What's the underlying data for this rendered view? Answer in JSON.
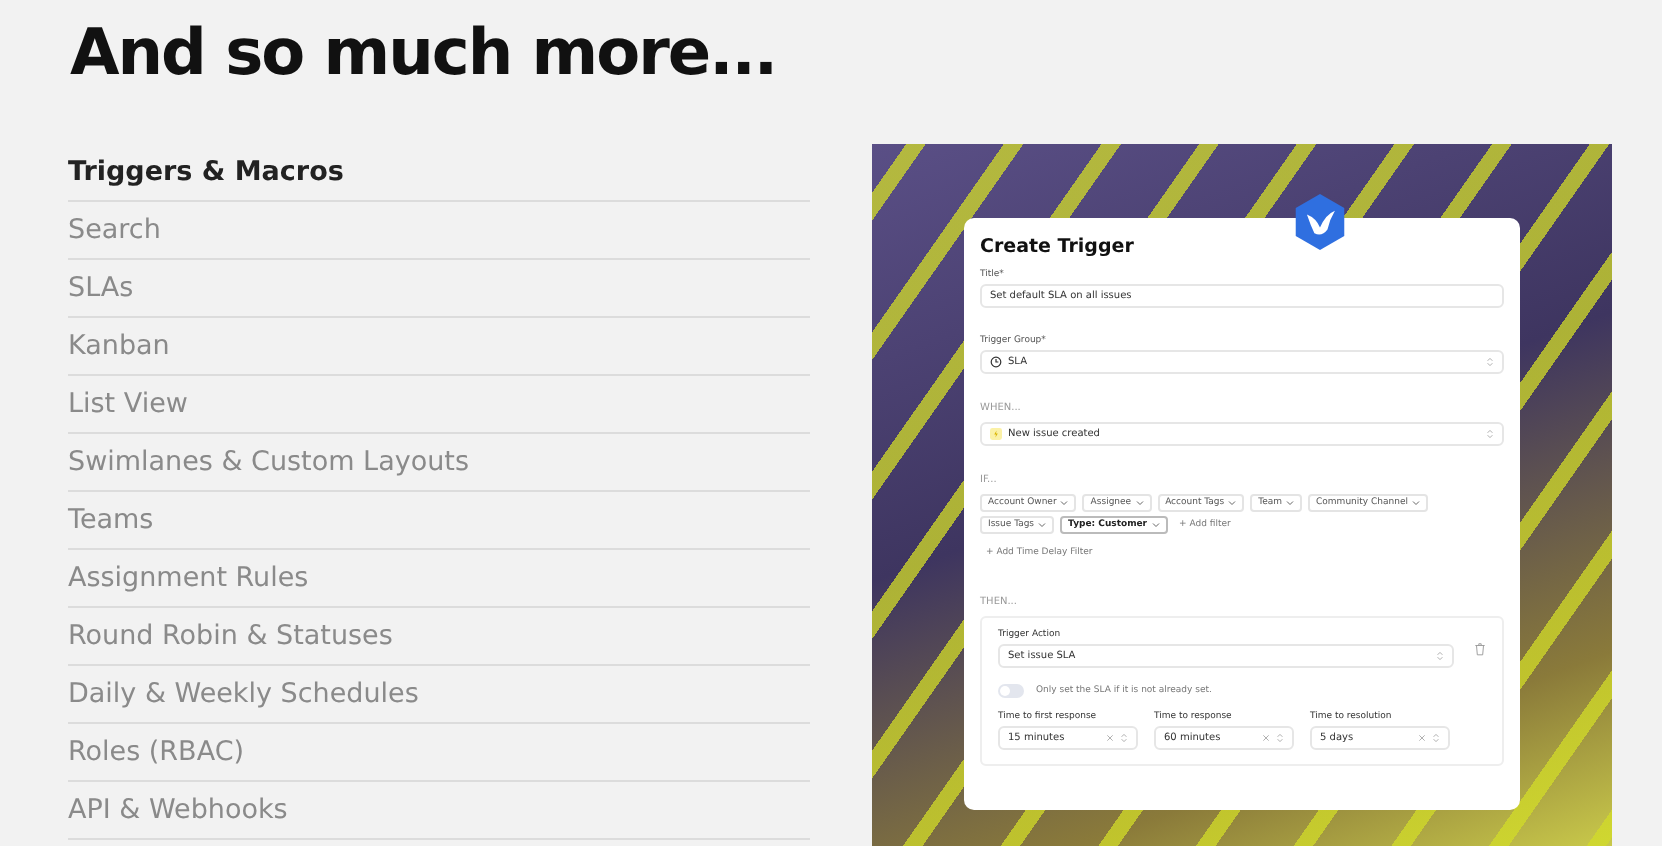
{
  "heading": "And so much more...",
  "features": [
    {
      "label": "Triggers & Macros",
      "selected": true
    },
    {
      "label": "Search",
      "selected": false
    },
    {
      "label": "SLAs",
      "selected": false
    },
    {
      "label": "Kanban",
      "selected": false
    },
    {
      "label": "List View",
      "selected": false
    },
    {
      "label": "Swimlanes & Custom Layouts",
      "selected": false
    },
    {
      "label": "Teams",
      "selected": false
    },
    {
      "label": "Assignment Rules",
      "selected": false
    },
    {
      "label": "Round Robin & Statuses",
      "selected": false
    },
    {
      "label": "Daily & Weekly Schedules",
      "selected": false
    },
    {
      "label": "Roles (RBAC)",
      "selected": false
    },
    {
      "label": "API & Webhooks",
      "selected": false
    }
  ],
  "trigger_form": {
    "title": "Create Trigger",
    "fields": [
      {
        "label": "Title*",
        "value": "Set default SLA on all issues",
        "kind": "text"
      },
      {
        "label": "Trigger Group*",
        "value": "SLA",
        "kind": "select"
      }
    ],
    "when": {
      "label": "WHEN...",
      "value": "New issue created"
    },
    "if": {
      "label": "IF...",
      "filters": [
        {
          "label": "Account Owner",
          "selected": false
        },
        {
          "label": "Assignee",
          "selected": false
        },
        {
          "label": "Account Tags",
          "selected": false
        },
        {
          "label": "Team",
          "selected": false
        },
        {
          "label": "Community Channel",
          "selected": false
        },
        {
          "label": "Issue Tags",
          "selected": false
        },
        {
          "label": "Type: Customer",
          "selected": true
        }
      ],
      "add_filter": "+ Add filter",
      "add_time_delay": "+ Add Time Delay Filter"
    },
    "then": {
      "label": "THEN...",
      "action_label": "Trigger Action",
      "action_value": "Set issue SLA",
      "toggle": {
        "label": "Only set the SLA if it is not already set.",
        "on": false
      },
      "times": [
        {
          "label": "Time to first response",
          "value": "15 minutes"
        },
        {
          "label": "Time to response",
          "value": "60 minutes"
        },
        {
          "label": "Time to resolution",
          "value": "5 days"
        }
      ]
    }
  }
}
